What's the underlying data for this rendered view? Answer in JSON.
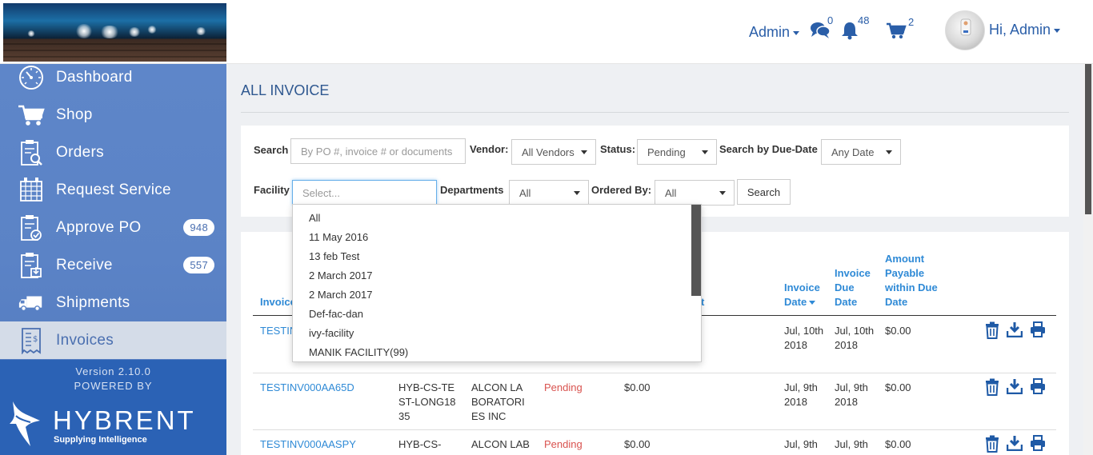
{
  "header": {
    "admin_menu_label": "Admin",
    "messages_count": "0",
    "notifications_count": "48",
    "cart_count": "2",
    "user_greeting": "Hi, Admin"
  },
  "sidebar": {
    "items": [
      {
        "label": "Dashboard",
        "icon": "dashboard-gauge-icon"
      },
      {
        "label": "Shop",
        "icon": "cart-icon"
      },
      {
        "label": "Orders",
        "icon": "orders-clipboard-icon"
      },
      {
        "label": "Request Service",
        "icon": "request-service-icon"
      },
      {
        "label": "Approve PO",
        "icon": "approve-clipboard-icon",
        "badge": "948"
      },
      {
        "label": "Receive",
        "icon": "receive-clipboard-icon",
        "badge": "557"
      },
      {
        "label": "Shipments",
        "icon": "truck-icon"
      },
      {
        "label": "Invoices",
        "icon": "invoice-icon"
      }
    ],
    "active": "Invoices",
    "version": "Version 2.10.0",
    "powered_by": "POWERED BY",
    "brand_name": "HYBRENT",
    "brand_tagline": "Supplying Intelligence"
  },
  "page": {
    "title": "ALL INVOICE"
  },
  "filters": {
    "search_label": "Search",
    "search_placeholder": "By PO #, invoice # or documents",
    "vendor_label": "Vendor:",
    "vendor_value": "All Vendors",
    "status_label": "Status:",
    "status_value": "Pending",
    "due_date_label": "Search by Due-Date",
    "due_date_value": "Any Date",
    "facility_label": "Facility",
    "facility_placeholder": "Select...",
    "departments_label": "Departments",
    "departments_value": "All",
    "ordered_by_label": "Ordered By:",
    "ordered_by_value": "All",
    "search_button": "Search"
  },
  "facility_dropdown": {
    "options": [
      "All",
      "11 May 2016",
      "13 feb Test",
      "2 March 2017",
      "2 March 2017",
      "Def-fac-dan",
      "ivy-facility",
      "MANIK FACILITY(99)"
    ]
  },
  "table": {
    "headers": {
      "invoice": "Invoice",
      "amount_partial": "t",
      "invoice_date": "Invoice Date",
      "invoice_due_date": "Invoice Due Date",
      "amount_payable": "Amount Payable within Due Date"
    },
    "rows": [
      {
        "invoice": "TESTIN",
        "po": "",
        "vendor": "",
        "status": "",
        "amount": "",
        "invoice_date": "Jul, 10th 2018",
        "due_date": "Jul, 10th 2018",
        "payable": "$0.00"
      },
      {
        "invoice": "TESTINV000AA65D",
        "po": "HYB-CS-TEST-LONG1835",
        "vendor": "ALCON LABORATORIES INC",
        "status": "Pending",
        "amount": "$0.00",
        "invoice_date": "Jul, 9th 2018",
        "due_date": "Jul, 9th 2018",
        "payable": "$0.00"
      },
      {
        "invoice": "TESTINV000AASPY",
        "po": "HYB-CS-",
        "vendor": "ALCON LAB",
        "status": "Pending",
        "amount": "$0.00",
        "invoice_date": "Jul, 9th",
        "due_date": "Jul, 9th",
        "payable": "$0.00"
      }
    ]
  },
  "colors": {
    "accent": "#2a5ea8",
    "link": "#2f8ad6",
    "sidebar": "#5b83c6",
    "sidebar_footer": "#2b62b5",
    "pending": "#d9534f"
  }
}
